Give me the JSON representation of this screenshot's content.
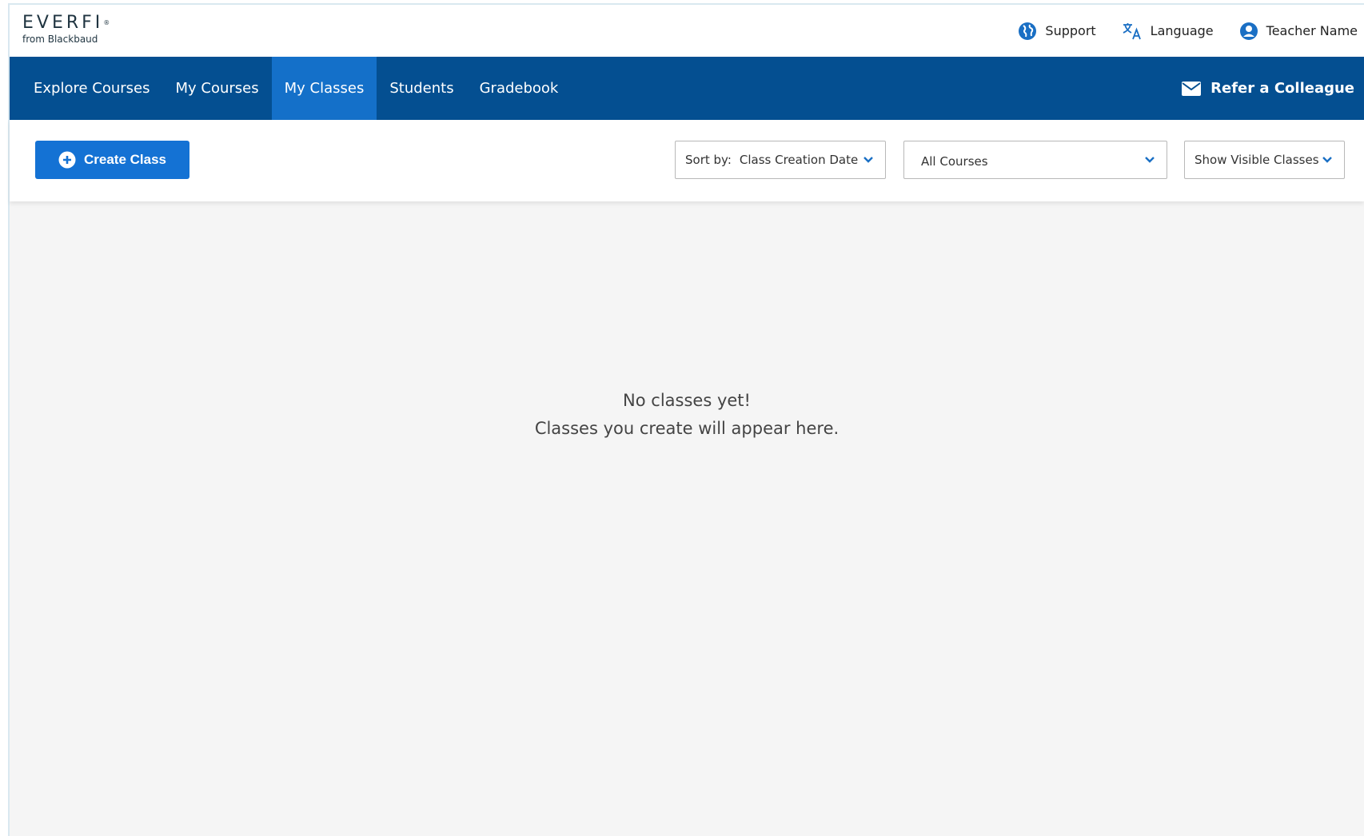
{
  "brand": {
    "logo_text": "EVERFI",
    "logo_sub": "from Blackbaud"
  },
  "topbar": {
    "support_label": "Support",
    "language_label": "Language",
    "user_label": "Teacher Name"
  },
  "nav": {
    "items": [
      {
        "label": "Explore Courses",
        "active": false
      },
      {
        "label": "My Courses",
        "active": false
      },
      {
        "label": "My Classes",
        "active": true
      },
      {
        "label": "Students",
        "active": false
      },
      {
        "label": "Gradebook",
        "active": false
      }
    ],
    "refer_label": "Refer a Colleague"
  },
  "toolbar": {
    "create_label": "Create Class",
    "sort_prefix": "Sort by:",
    "sort_value": "Class Creation Date",
    "course_filter_value": "All Courses",
    "visibility_value": "Show Visible Classes"
  },
  "empty_state": {
    "title": "No classes yet!",
    "message": "Classes you create will appear here."
  },
  "colors": {
    "nav_bg": "#044f91",
    "nav_active": "#1470c9",
    "primary_button": "#1472d4",
    "icon_blue": "#1a6fc4"
  }
}
